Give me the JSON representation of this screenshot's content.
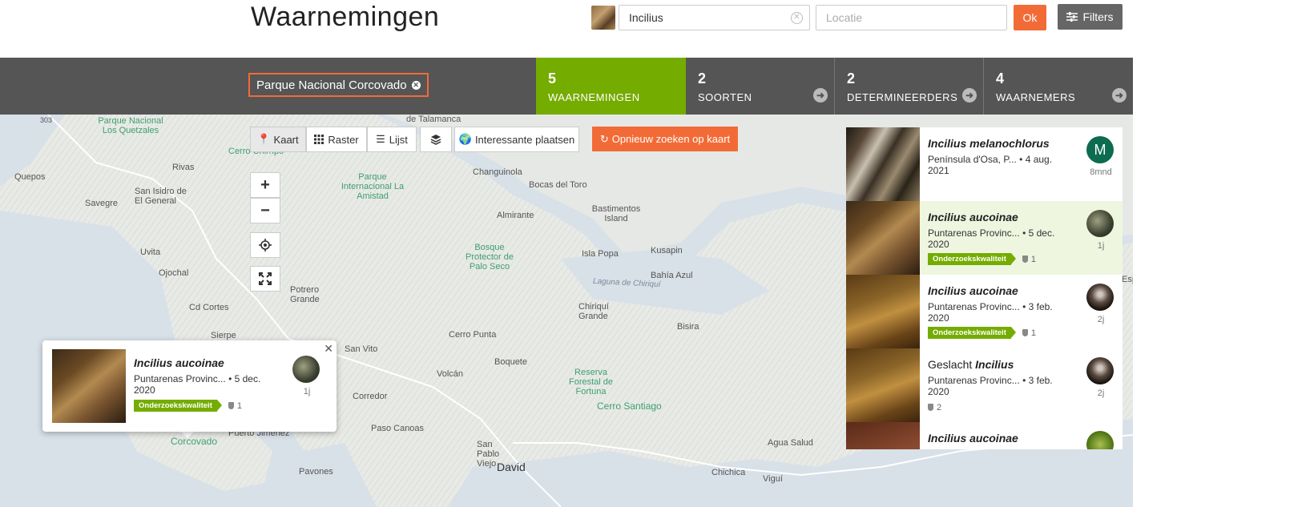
{
  "header": {
    "title": "Waarnemingen",
    "taxon_value": "Incilius",
    "location_placeholder": "Locatie",
    "ok_label": "Ok",
    "filters_label": "Filters"
  },
  "stats": {
    "place_chip": "Parque Nacional Corcovado",
    "observations": {
      "count": "5",
      "label": "WAARNEMINGEN"
    },
    "species": {
      "count": "2",
      "label": "SOORTEN"
    },
    "identifiers": {
      "count": "2",
      "label": "DETERMINEERDERS"
    },
    "observers": {
      "count": "4",
      "label": "WAARNEMERS"
    }
  },
  "map_controls": {
    "kaart": "Kaart",
    "raster": "Raster",
    "lijst": "Lijst",
    "interesting_places": "Interessante plaatsen",
    "redo_search": "Opnieuw zoeken op kaart"
  },
  "map_labels": [
    {
      "text": "303",
      "kind": "road"
    },
    {
      "text": "Parque Nacional Los Quetzales",
      "kind": "park"
    },
    {
      "text": "Cerro Chirripó",
      "kind": "park"
    },
    {
      "text": "Quepos",
      "kind": "place"
    },
    {
      "text": "Rivas",
      "kind": "place"
    },
    {
      "text": "San Isidro de El General",
      "kind": "place"
    },
    {
      "text": "Savegre",
      "kind": "place"
    },
    {
      "text": "Uvita",
      "kind": "place"
    },
    {
      "text": "Ojochal",
      "kind": "place"
    },
    {
      "text": "Cd Cortes",
      "kind": "place"
    },
    {
      "text": "Sierpe",
      "kind": "place"
    },
    {
      "text": "Potrero Grande",
      "kind": "place"
    },
    {
      "text": "Parque Internacional La Amistad",
      "kind": "park"
    },
    {
      "text": "Changuinola",
      "kind": "place"
    },
    {
      "text": "Bocas del Toro",
      "kind": "place"
    },
    {
      "text": "Almirante",
      "kind": "place"
    },
    {
      "text": "Bastimentos Island",
      "kind": "place"
    },
    {
      "text": "Bosque Protector de Palo Seco",
      "kind": "park"
    },
    {
      "text": "Isla Popa",
      "kind": "place"
    },
    {
      "text": "Kusapin",
      "kind": "place"
    },
    {
      "text": "Bahía Azul",
      "kind": "place"
    },
    {
      "text": "Laguna de Chiriquí",
      "kind": "water"
    },
    {
      "text": "Chiriquí Grande",
      "kind": "place"
    },
    {
      "text": "Bisira",
      "kind": "place"
    },
    {
      "text": "Cerro Punta",
      "kind": "place"
    },
    {
      "text": "San Vito",
      "kind": "place"
    },
    {
      "text": "Volcán",
      "kind": "place"
    },
    {
      "text": "Boquete",
      "kind": "place"
    },
    {
      "text": "Reserva Forestal de Fortuna",
      "kind": "park"
    },
    {
      "text": "Cerro Santiago",
      "kind": "park"
    },
    {
      "text": "Corredor",
      "kind": "place"
    },
    {
      "text": "Paso Canoas",
      "kind": "place"
    },
    {
      "text": "Puerto Jiménez",
      "kind": "place"
    },
    {
      "text": "Corcovado",
      "kind": "park"
    },
    {
      "text": "San Pablo Viejo",
      "kind": "place"
    },
    {
      "text": "David",
      "kind": "city"
    },
    {
      "text": "Pavones",
      "kind": "place"
    },
    {
      "text": "Chichica",
      "kind": "place"
    },
    {
      "text": "Agua Salud",
      "kind": "place"
    },
    {
      "text": "Viguí",
      "kind": "place"
    },
    {
      "text": "de Talamanca",
      "kind": "place"
    },
    {
      "text": "Esp",
      "kind": "place"
    }
  ],
  "popup": {
    "name": "Incilius aucoinae",
    "place": "Puntarenas Provinc...",
    "date": "5 dec. 2020",
    "badge": "Onderzoekskwaliteit",
    "ids": "1",
    "age": "1j"
  },
  "observations": [
    {
      "prefix": "",
      "name": "Incilius melanochlorus",
      "place": "Península d'Osa, P...",
      "date": "4 aug. 2021",
      "badge": "",
      "ids": "",
      "avatar": "M",
      "age": "8mnd"
    },
    {
      "prefix": "",
      "name": "Incilius aucoinae",
      "place": "Puntarenas Provinc...",
      "date": "5 dec. 2020",
      "badge": "Onderzoekskwaliteit",
      "ids": "1",
      "avatar": "",
      "age": "1j"
    },
    {
      "prefix": "",
      "name": "Incilius aucoinae",
      "place": "Puntarenas Provinc...",
      "date": "3 feb. 2020",
      "badge": "Onderzoekskwaliteit",
      "ids": "1",
      "avatar": "",
      "age": "2j"
    },
    {
      "prefix": "Geslacht",
      "name": "Incilius",
      "place": "Puntarenas Provinc...",
      "date": "3 feb. 2020",
      "badge": "",
      "ids": "2",
      "avatar": "",
      "age": "2j"
    },
    {
      "prefix": "",
      "name": "Incilius aucoinae",
      "place": "",
      "date": "",
      "badge": "",
      "ids": "",
      "avatar": "",
      "age": ""
    }
  ],
  "colors": {
    "accent": "#f26b36",
    "green": "#74ac00",
    "bar": "#555555"
  },
  "icons": [
    "search-clear-icon",
    "filters-icon",
    "arrow-right-icon",
    "map-marker-icon",
    "grid-icon",
    "list-icon",
    "layers-icon",
    "globe-icon",
    "refresh-icon",
    "locate-icon",
    "fullscreen-icon",
    "shield-icon",
    "close-icon"
  ]
}
